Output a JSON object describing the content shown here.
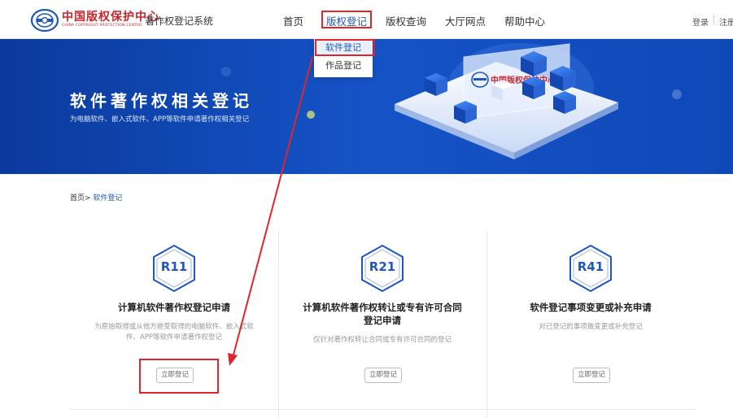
{
  "header": {
    "logo_cn": "中国版权保护中心",
    "logo_en": "CHINA COPYRIGHT PROTECTION CENTER",
    "system_name": "著作权登记系统",
    "nav": [
      {
        "label": "首页"
      },
      {
        "label": "版权登记"
      },
      {
        "label": "版权查询"
      },
      {
        "label": "大厅网点"
      },
      {
        "label": "帮助中心"
      }
    ],
    "login": "登录",
    "register": "注册"
  },
  "dropdown": {
    "items": [
      {
        "label": "软件登记"
      },
      {
        "label": "作品登记"
      }
    ]
  },
  "banner": {
    "title": "软件著作权相关登记",
    "subtitle": "为电脑软件、嵌入式软件、APP等软件申请著作权相关登记",
    "art_logo_text": "中国版权保护中心"
  },
  "breadcrumb": {
    "home": "首页>",
    "current": "软件登记"
  },
  "cards": [
    {
      "code": "R11",
      "title": "计算机软件著作权登记申请",
      "desc": "为原始取得或从他方继受取得的电脑软件、嵌入式软件、APP等软件申请著作权登记",
      "button": "立即登记"
    },
    {
      "code": "R21",
      "title": "计算机软件著作权转让或专有许可合同登记申请",
      "desc": "仅针对著作权转让合同或专有许可合同的登记",
      "button": "立即登记"
    },
    {
      "code": "R41",
      "title": "软件登记事项变更或补充申请",
      "desc": "对已登记的事项做变更或补充登记",
      "button": "立即登记"
    }
  ],
  "colors": {
    "primary": "#1f58b8",
    "banner_dark": "#0b3a9c",
    "annotation_red": "#e0262b",
    "logo_red": "#c8252c"
  },
  "icons": {
    "logo": "copyright-center-logo-icon",
    "card_badge": "hexagon-badge-icon"
  }
}
